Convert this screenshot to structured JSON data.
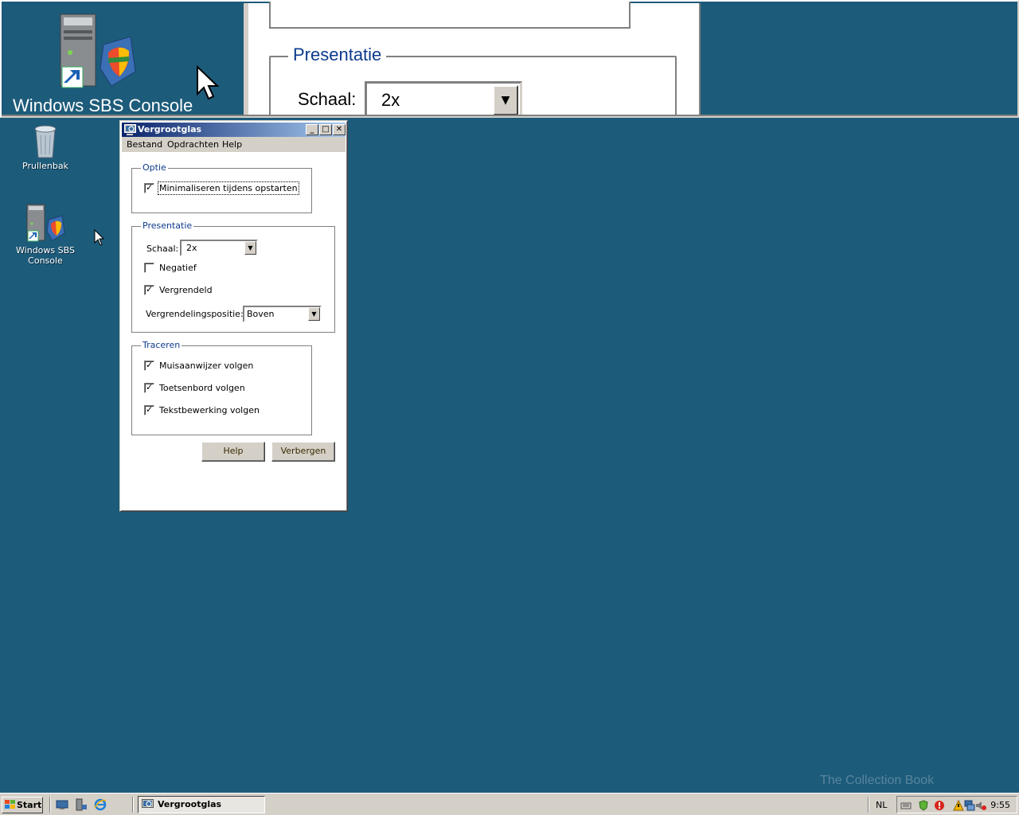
{
  "magnifier": {
    "icon_label": "Windows SBS Console",
    "group_title": "Presentatie",
    "scale_label": "Schaal:",
    "scale_value": "2x"
  },
  "desktop": {
    "icons": [
      {
        "label": "Prullenbak"
      },
      {
        "label": "Windows SBS Console"
      }
    ]
  },
  "dialog": {
    "title": "Vergrootglas",
    "menu": [
      "Bestand",
      "Opdrachten",
      "Help"
    ],
    "optie": {
      "title": "Optie",
      "minimize_label": "Minimaliseren tijdens opstarten",
      "minimize_checked": true
    },
    "presentatie": {
      "title": "Presentatie",
      "scale_label": "Schaal:",
      "scale_value": "2x",
      "negative_label": "Negatief",
      "negative_checked": false,
      "locked_label": "Vergrendeld",
      "locked_checked": true,
      "lockpos_label": "Vergrendelingspositie:",
      "lockpos_value": "Boven"
    },
    "traceren": {
      "title": "Traceren",
      "mouse_label": "Muisaanwijzer volgen",
      "mouse_checked": true,
      "keyboard_label": "Toetsenbord volgen",
      "keyboard_checked": true,
      "text_label": "Tekstbewerking volgen",
      "text_checked": true
    },
    "buttons": {
      "help": "Help",
      "hide": "Verbergen"
    }
  },
  "taskbar": {
    "start_label": "Start",
    "task_label": "Vergrootglas",
    "language": "NL",
    "clock": "9:55"
  },
  "watermark": "The Collection Book"
}
